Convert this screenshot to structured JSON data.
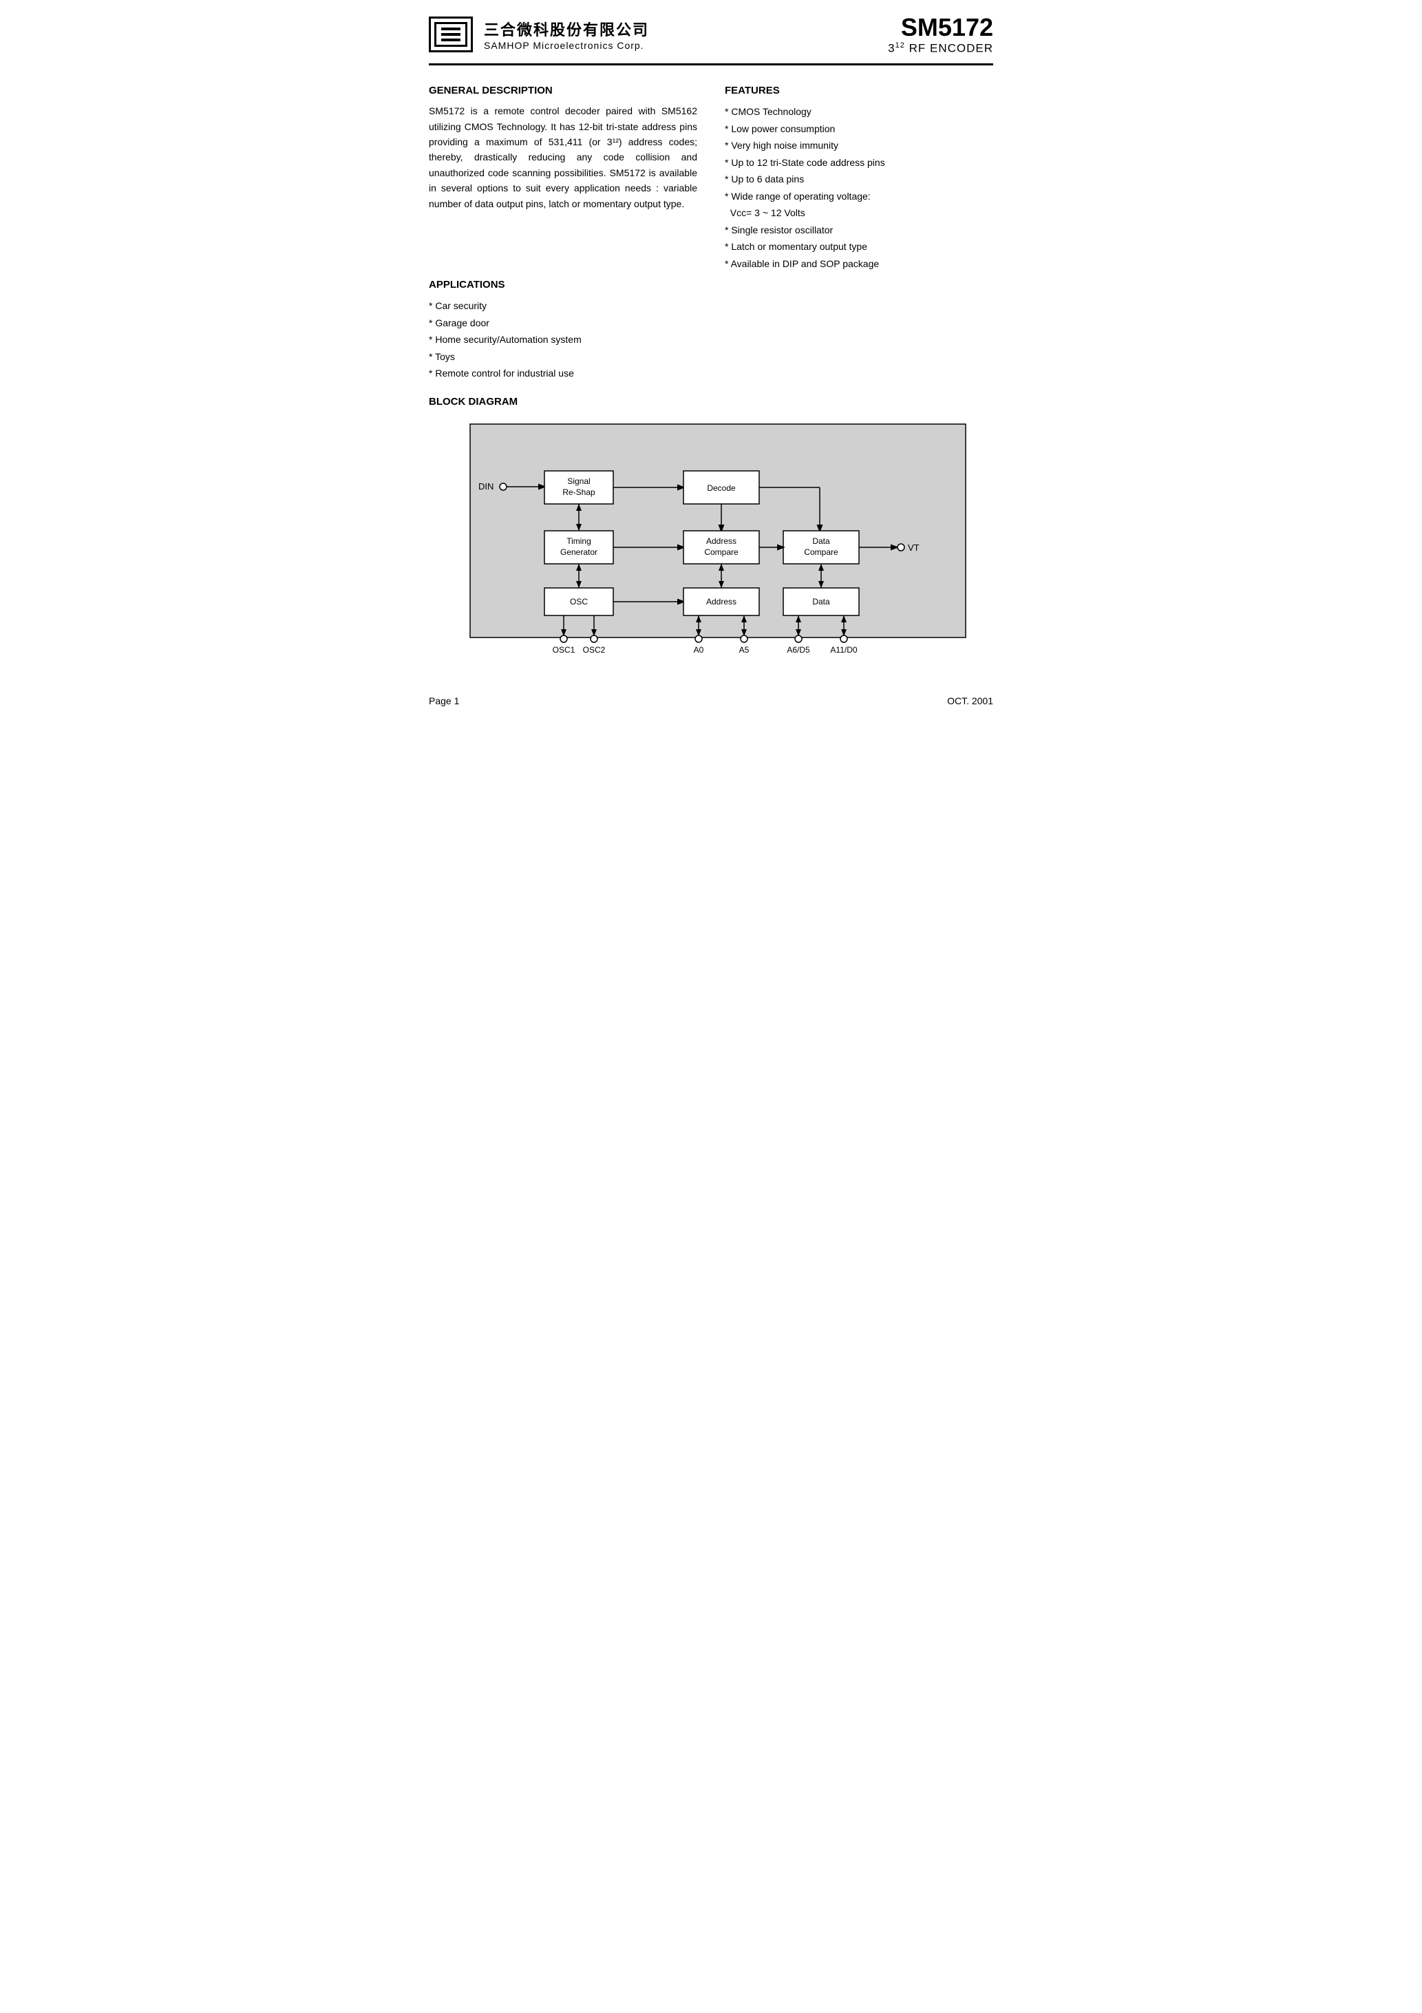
{
  "header": {
    "chinese_company": "三合微科股份有限公司",
    "english_company": "SAMHOP Microelectronics Corp.",
    "chip_name": "SM5172",
    "chip_subtitle": "3",
    "chip_superscript": "12",
    "chip_subtitle_rest": " RF ENCODER"
  },
  "general_description": {
    "title": "GENERAL DESCRIPTION",
    "body": "SM5172 is a remote control decoder paired with SM5162 utilizing CMOS Technology. It has 12-bit tri-state address pins providing a maximum of 531,411 (or 3¹²) address codes; thereby, drastically reducing any code collision and unauthorized code scanning possibilities. SM5172 is available in several options to suit every application needs : variable number of data output pins, latch or momentary output type."
  },
  "features": {
    "title": "FEATURES",
    "items": [
      "CMOS Technology",
      "Low power consumption",
      "Very high noise immunity",
      "Up to 12 tri-State code address pins",
      "Up to 6 data pins",
      "Wide range of operating voltage: Vcc= 3 ~ 12 Volts",
      "Single resistor oscillator",
      "Latch or momentary output type",
      "Available in DIP and SOP package"
    ]
  },
  "applications": {
    "title": "APPLICATIONS",
    "items": [
      "Car security",
      "Garage door",
      "Home security/Automation system",
      "Toys",
      "Remote control for industrial use"
    ]
  },
  "block_diagram": {
    "title": "BLOCK DIAGRAM"
  },
  "footer": {
    "page": "Page 1",
    "date": "OCT. 2001"
  }
}
